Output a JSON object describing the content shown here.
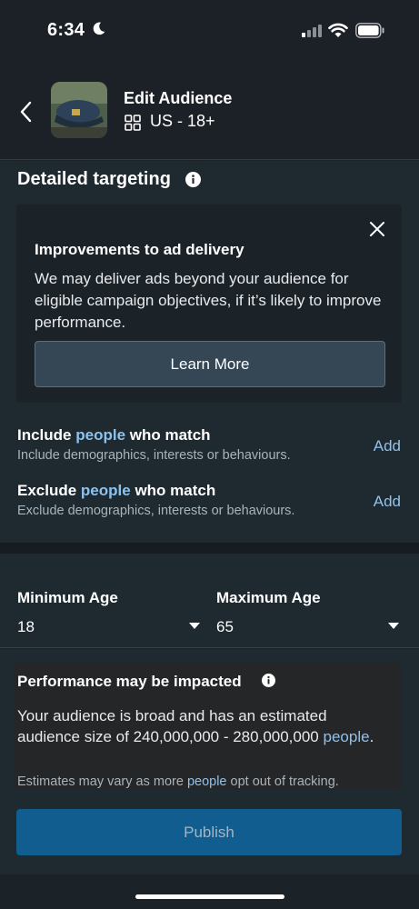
{
  "status_bar": {
    "time": "6:34",
    "icons": [
      "moon-icon",
      "signal-icon",
      "wifi-icon",
      "battery-icon"
    ]
  },
  "header": {
    "title": "Edit Audience",
    "subtitle": "US - 18+",
    "back_icon": "chevron-left-icon",
    "audience_icon": "grid-icon"
  },
  "detailed_targeting": {
    "title": "Detailed targeting",
    "info_icon": "info-icon",
    "notice": {
      "title": "Improvements to ad delivery",
      "body": "We may deliver ads beyond your audience for eligible campaign objectives, if it’s likely to improve performance.",
      "button": "Learn More",
      "close_icon": "close-icon"
    },
    "include": {
      "title_pre": "Include ",
      "title_hl": "people",
      "title_post": " who match",
      "subtitle": "Include demographics, interests or behaviours.",
      "action": "Add"
    },
    "exclude": {
      "title_pre": "Exclude ",
      "title_hl": "people",
      "title_post": " who match",
      "subtitle": "Exclude demographics, interests or behaviours.",
      "action": "Add"
    }
  },
  "age": {
    "min_label": "Minimum Age",
    "min_value": "18",
    "max_label": "Maximum Age",
    "max_value": "65"
  },
  "performance": {
    "title": "Performance may be impacted",
    "body_pre": "Your audience is broad and has an estimated audience size of 240,000,000 - 280,000,000 ",
    "body_hl": "people",
    "body_post": ".",
    "note_pre": "Estimates may vary as more ",
    "note_hl": "people",
    "note_post": " opt out of tracking."
  },
  "publish_button": "Publish",
  "colors": {
    "background": "#1b2228",
    "section": "#1f2930",
    "link": "#8ec2ee",
    "publish": "#125d8f"
  }
}
